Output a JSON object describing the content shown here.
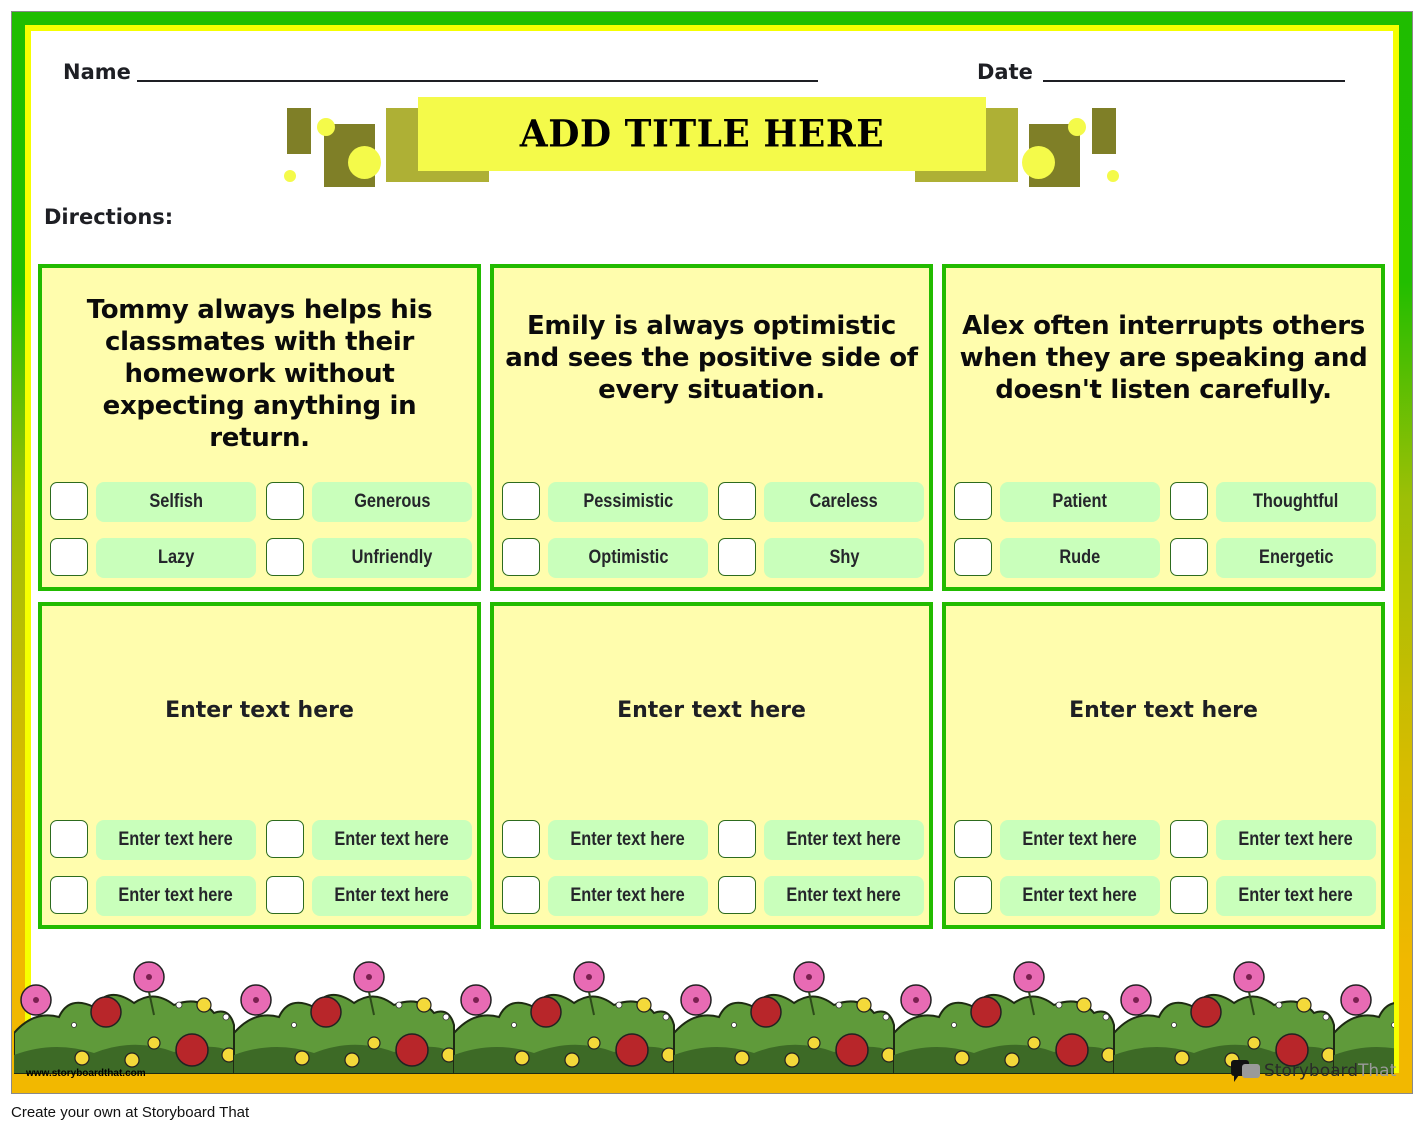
{
  "header": {
    "name_label": "Name",
    "date_label": "Date",
    "title": "ADD TITLE HERE",
    "directions_label": "Directions:"
  },
  "colors": {
    "outer_border_top": "#1fbd00",
    "outer_border_bottom": "#f2b800",
    "inner_border": "#f6ff00",
    "panel_border": "#22bb00",
    "panel_fill": "#fffdad",
    "option_fill": "#c9ffbb",
    "title_banner": "#f4fa4a",
    "deco_dark": "#7f7f27",
    "deco_mid": "#aeb035"
  },
  "panels": [
    {
      "question": "Tommy always helps his classmates with their homework without expecting anything in return.",
      "options": [
        "Selfish",
        "Generous",
        "Lazy",
        "Unfriendly"
      ]
    },
    {
      "question": "Emily is always optimistic and sees the positive side of every situation.",
      "options": [
        "Pessimistic",
        "Careless",
        "Optimistic",
        "Shy"
      ]
    },
    {
      "question": "Alex often interrupts others when they are speaking and doesn't listen carefully.",
      "options": [
        "Patient",
        "Thoughtful",
        "Rude",
        "Energetic"
      ]
    },
    {
      "question": "Enter text here",
      "options": [
        "Enter text here",
        "Enter text here",
        "Enter text here",
        "Enter text here"
      ]
    },
    {
      "question": "Enter text here",
      "options": [
        "Enter text here",
        "Enter text here",
        "Enter text here",
        "Enter text here"
      ]
    },
    {
      "question": "Enter text here",
      "options": [
        "Enter text here",
        "Enter text here",
        "Enter text here",
        "Enter text here"
      ]
    }
  ],
  "watermark": {
    "url": "www.storyboardthat.com",
    "logo_part1": "Storyboard",
    "logo_part2": "That"
  },
  "footer": {
    "text": "Create your own at Storyboard That"
  }
}
